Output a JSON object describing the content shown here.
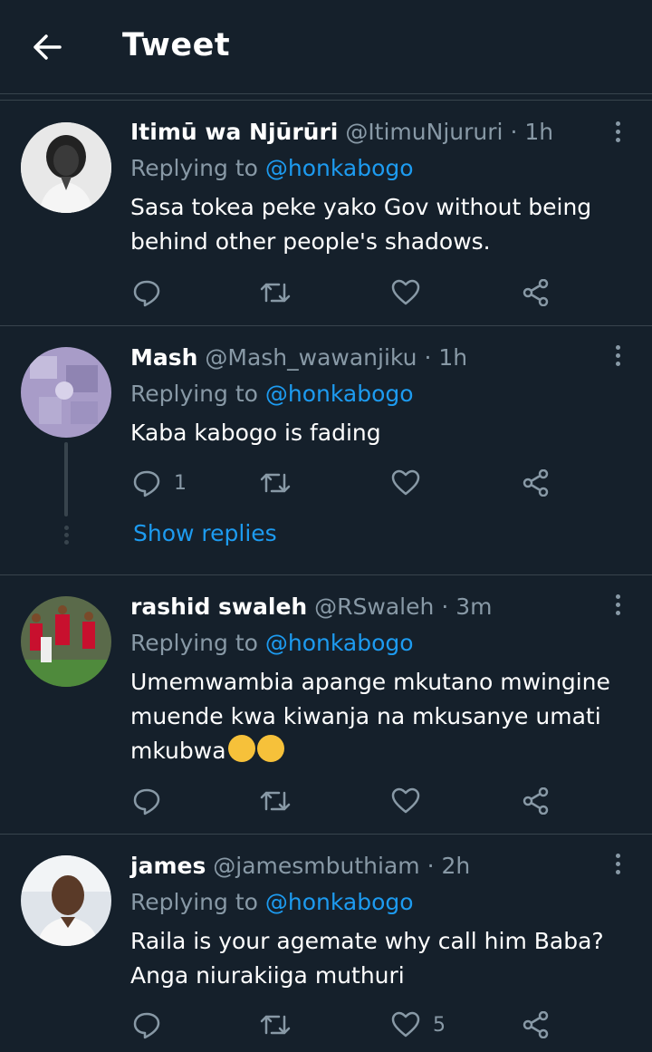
{
  "header": {
    "title": "Tweet"
  },
  "tweets": [
    {
      "name": "Itimū wa Njūrūri",
      "handle": "@ItimuNjururi",
      "time": "· 1h",
      "replying_prefix": "Replying to ",
      "replying_to": "@honkabogo",
      "text": "Sasa tokea peke yako Gov without being behind other people's shadows.",
      "reply_count": "",
      "retweet_count": "",
      "like_count": ""
    },
    {
      "name": "Mash",
      "handle": "@Mash_wawanjiku",
      "time": "· 1h",
      "replying_prefix": "Replying to ",
      "replying_to": "@honkabogo",
      "text": "Kaba kabogo is fading",
      "reply_count": "1",
      "retweet_count": "",
      "like_count": "",
      "show_replies": "Show replies"
    },
    {
      "name": "rashid swaleh",
      "handle": "@RSwaleh",
      "time": "· 3m",
      "replying_prefix": "Replying to ",
      "replying_to": "@honkabogo",
      "text": "Umemwambia apange mkutano mwingine muende kwa kiwanja na mkusanye umati mkubwa",
      "emoji": "rolling-on-floor-laughing",
      "reply_count": "",
      "retweet_count": "",
      "like_count": ""
    },
    {
      "name": "james",
      "handle": "@jamesmbuthiam",
      "time": "· 2h",
      "replying_prefix": "Replying to ",
      "replying_to": "@honkabogo",
      "text": "Raila is your agemate why call him Baba? Anga niurakiiga muthuri",
      "reply_count": "",
      "retweet_count": "",
      "like_count": "5"
    }
  ],
  "colors": {
    "background": "#15202b",
    "divider": "#38444d",
    "secondary_text": "#8899a6",
    "accent": "#1d9bf0"
  },
  "icons": {
    "back": "arrow-left-icon",
    "more": "more-vertical-icon",
    "reply": "reply-icon",
    "retweet": "retweet-icon",
    "like": "heart-icon",
    "share": "share-icon"
  }
}
